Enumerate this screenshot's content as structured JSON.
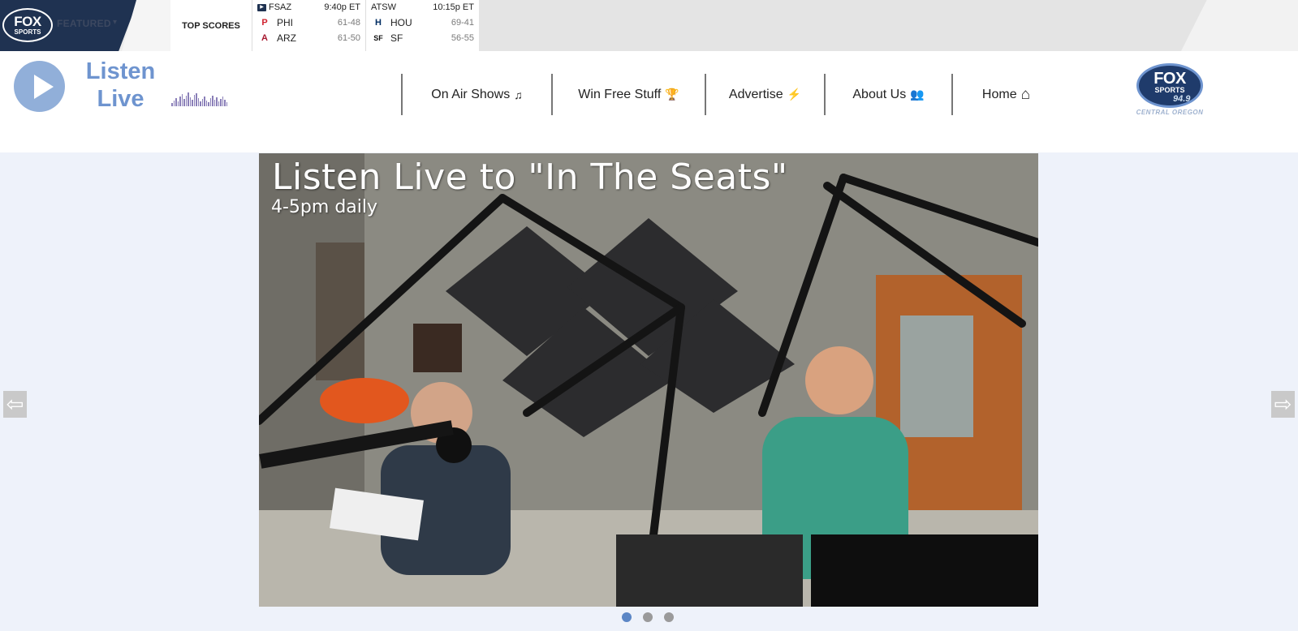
{
  "topbar": {
    "brand": {
      "line1": "FOX",
      "line2": "SPORTS"
    },
    "featured_label": "FEATURED",
    "top_scores_label": "TOP SCORES",
    "games": [
      {
        "network": "FSAZ",
        "time": "9:40p ET",
        "teams": [
          {
            "logo": "phillies-logo-icon",
            "glyph": "P",
            "color": "#d0202e",
            "abbr": "PHI",
            "record": "61-48"
          },
          {
            "logo": "diamondbacks-logo-icon",
            "glyph": "A",
            "color": "#a71930",
            "abbr": "ARZ",
            "record": "61-50"
          }
        ]
      },
      {
        "network": "ATSW",
        "time": "10:15p ET",
        "teams": [
          {
            "logo": "astros-logo-icon",
            "glyph": "H",
            "color": "#002d62",
            "abbr": "HOU",
            "record": "69-41"
          },
          {
            "logo": "giants-logo-icon",
            "glyph": "SF",
            "color": "#111111",
            "abbr": "SF",
            "record": "56-55"
          }
        ]
      }
    ]
  },
  "header": {
    "listen_live": {
      "line1": "Listen",
      "line2": "Live"
    },
    "nav": [
      {
        "label": "On Air Shows",
        "icon": "music-note-icon",
        "glyph": "♫"
      },
      {
        "label": "Win Free Stuff",
        "icon": "trophy-icon",
        "glyph": "🏆"
      },
      {
        "label": "Advertise",
        "icon": "bolt-icon",
        "glyph": "⚡"
      },
      {
        "label": "About Us",
        "icon": "users-icon",
        "glyph": "👥"
      },
      {
        "label": "Home",
        "icon": "home-icon",
        "glyph": "⌂"
      }
    ],
    "station_logo": {
      "line1": "FOX",
      "line2": "SPORTS",
      "frequency": "94.9",
      "region": "CENTRAL OREGON"
    }
  },
  "slider": {
    "title": "Listen Live to \"In The Seats\"",
    "subtitle": "4-5pm daily",
    "prev_glyph": "⇦",
    "next_glyph": "⇨",
    "slide_count": 3,
    "active_slide": 1
  },
  "colors": {
    "navy": "#1f3251",
    "accent_blue": "#6e94cf",
    "page_bg": "#eef2fa",
    "active_dot": "#5b86c5"
  }
}
